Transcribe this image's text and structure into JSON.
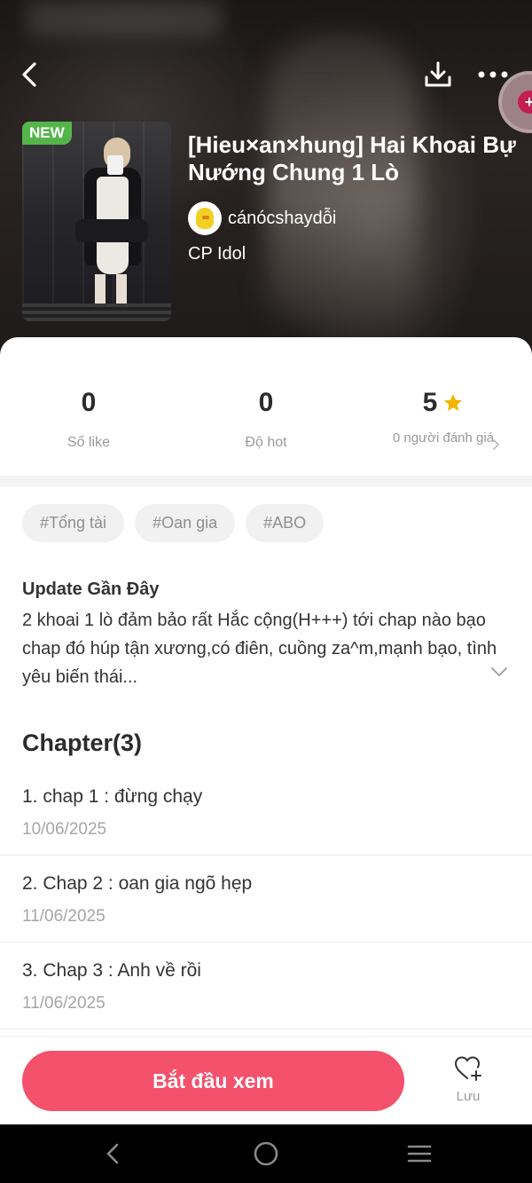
{
  "header": {
    "new_badge": "NEW",
    "title": "[Hieu×an×hung] Hai Khoai Bự Nướng Chung 1 Lò",
    "author": "cánócshaydỗi",
    "genre": "CP Idol",
    "icons": {
      "back": "back-arrow-icon",
      "download": "download-icon",
      "more": "more-dots-icon"
    }
  },
  "stats": {
    "likes": {
      "value": "0",
      "label": "Số like"
    },
    "hot": {
      "value": "0",
      "label": "Độ hot"
    },
    "rating": {
      "value": "5",
      "label": "0 người đánh giá"
    }
  },
  "tags": [
    "#Tổng tài",
    "#Oan gia",
    "#ABO"
  ],
  "update": {
    "title": "Update Gần Đây",
    "text": "2 khoai 1 lò đảm bảo rất Hắc cộng(H+++) tới chap nào bạo chap đó húp tận xương,có điên, cuồng za^m,mạnh bạo, tình yêu biến thái..."
  },
  "chapters": {
    "title": "Chapter(3)",
    "items": [
      {
        "name": "1. chap 1 : đừng chạy",
        "date": "10/06/2025"
      },
      {
        "name": "2. Chap 2 : oan gia ngõ hẹp",
        "date": "11/06/2025"
      },
      {
        "name": "3. Chap 3 : Anh về rồi",
        "date": "11/06/2025"
      }
    ]
  },
  "bottom": {
    "start_label": "Bắt đầu xem",
    "save_label": "Lưu"
  },
  "colors": {
    "accent": "#f4516c",
    "new_badge": "#55b54a",
    "star": "#f5b400"
  }
}
